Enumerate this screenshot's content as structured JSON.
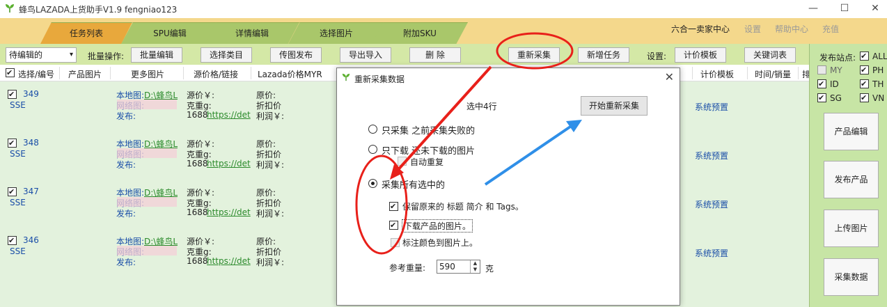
{
  "window": {
    "title": "蜂鸟LAZADA上货助手V1.9  fengniao123",
    "minimize": "—",
    "maximize": "☐",
    "close": "✕"
  },
  "tabs": [
    {
      "label": "任务列表",
      "active": true
    },
    {
      "label": "SPU编辑"
    },
    {
      "label": "详情编辑"
    },
    {
      "label": "选择图片"
    },
    {
      "label": "附加SKU"
    }
  ],
  "topright": {
    "seller_center": "六合一卖家中心",
    "settings": "设置",
    "help": "帮助中心",
    "recharge": "充值"
  },
  "toolbar": {
    "status_select": "待编辑的",
    "batch_label": "批量操作:",
    "batch_edit": "批量编辑",
    "select_category": "选择类目",
    "upload_publish": "传图发布",
    "export_import": "导出导入",
    "delete": "删 除",
    "recollect": "重新采集",
    "new_task": "新增任务",
    "settings_label": "设置:",
    "price_template": "计价模板",
    "keyword_table": "关键词表"
  },
  "header": {
    "select_no": "选择/编号",
    "product_image": "产品图片",
    "more_images": "更多图片",
    "source_price": "源价格/链接",
    "lazada_price": "Lazada价格MYR",
    "price_template": "计价模板",
    "time_sales": "时间/销量",
    "extra": "排"
  },
  "rows": [
    {
      "no": "349",
      "tag": "SSE",
      "local_label": "本地图:",
      "local_path": "D:\\蜂鸟L",
      "net_label": "网络图:",
      "pub_label": "发布:",
      "src_price": "源价￥:",
      "weight": "克重g:",
      "src_prefix": "1688",
      "src_link": "https://det",
      "orig": "原价:",
      "discount": "折扣价",
      "profit": "利润￥:",
      "tmpl": "系统预置"
    },
    {
      "no": "348",
      "tag": "SSE",
      "local_label": "本地图:",
      "local_path": "D:\\蜂鸟L",
      "net_label": "网络图:",
      "pub_label": "发布:",
      "src_price": "源价￥:",
      "weight": "克重g:",
      "src_prefix": "1688",
      "src_link": "https://det",
      "orig": "原价:",
      "discount": "折扣价",
      "profit": "利润￥:",
      "tmpl": "系统预置"
    },
    {
      "no": "347",
      "tag": "SSE",
      "local_label": "本地图:",
      "local_path": "D:\\蜂鸟L",
      "net_label": "网络图:",
      "pub_label": "发布:",
      "src_price": "源价￥:",
      "weight": "克重g:",
      "src_prefix": "1688",
      "src_link": "https://det",
      "orig": "原价:",
      "discount": "折扣价",
      "profit": "利润￥:",
      "tmpl": "系统预置"
    },
    {
      "no": "346",
      "tag": "SSE",
      "local_label": "本地图:",
      "local_path": "D:\\蜂鸟L",
      "net_label": "网络图:",
      "pub_label": "发布:",
      "src_price": "源价￥:",
      "weight": "克重g:",
      "src_prefix": "1688",
      "src_link": "https://det",
      "orig": "原价:",
      "discount": "折扣价",
      "profit": "利润￥:",
      "tmpl": "系统预置"
    }
  ],
  "rpanel": {
    "publish_sites": "发布站点:",
    "sites": [
      {
        "code": "ALL",
        "checked": true
      },
      {
        "code": "MY",
        "checked": false
      },
      {
        "code": "PH",
        "checked": true
      },
      {
        "code": "ID",
        "checked": true
      },
      {
        "code": "TH",
        "checked": true
      },
      {
        "code": "SG",
        "checked": true
      },
      {
        "code": "VN",
        "checked": true
      }
    ],
    "product_edit": "产品编辑",
    "publish_product": "发布产品",
    "upload_images": "上传图片",
    "collect_data": "采集数据"
  },
  "dialog": {
    "title": "重新采集数据",
    "selected": "选中4行",
    "start_button": "开始重新采集",
    "opt_failed": "只采集 之前采集失败的",
    "opt_download": "只下载 还未下载的图片",
    "auto_repeat": "自动重复",
    "opt_all": "采集所有选中的",
    "keep_title": "保留原来的 标题 简介 和 Tags。",
    "download_images": "下载产品的图片。",
    "mark_color": "标注颜色到图片上。",
    "ref_weight_label": "参考重量:",
    "ref_weight_value": "590",
    "unit": "克"
  },
  "colors": {
    "tab_band": "#f4d88c",
    "tab": "#a9c76a",
    "tab_active": "#e8a83c",
    "toolbar": "#d4e8a6",
    "grid": "#e3f2dd",
    "right_panel": "#c7e5a5",
    "annotation_red": "#e8201a",
    "annotation_blue": "#2f8fe8"
  }
}
